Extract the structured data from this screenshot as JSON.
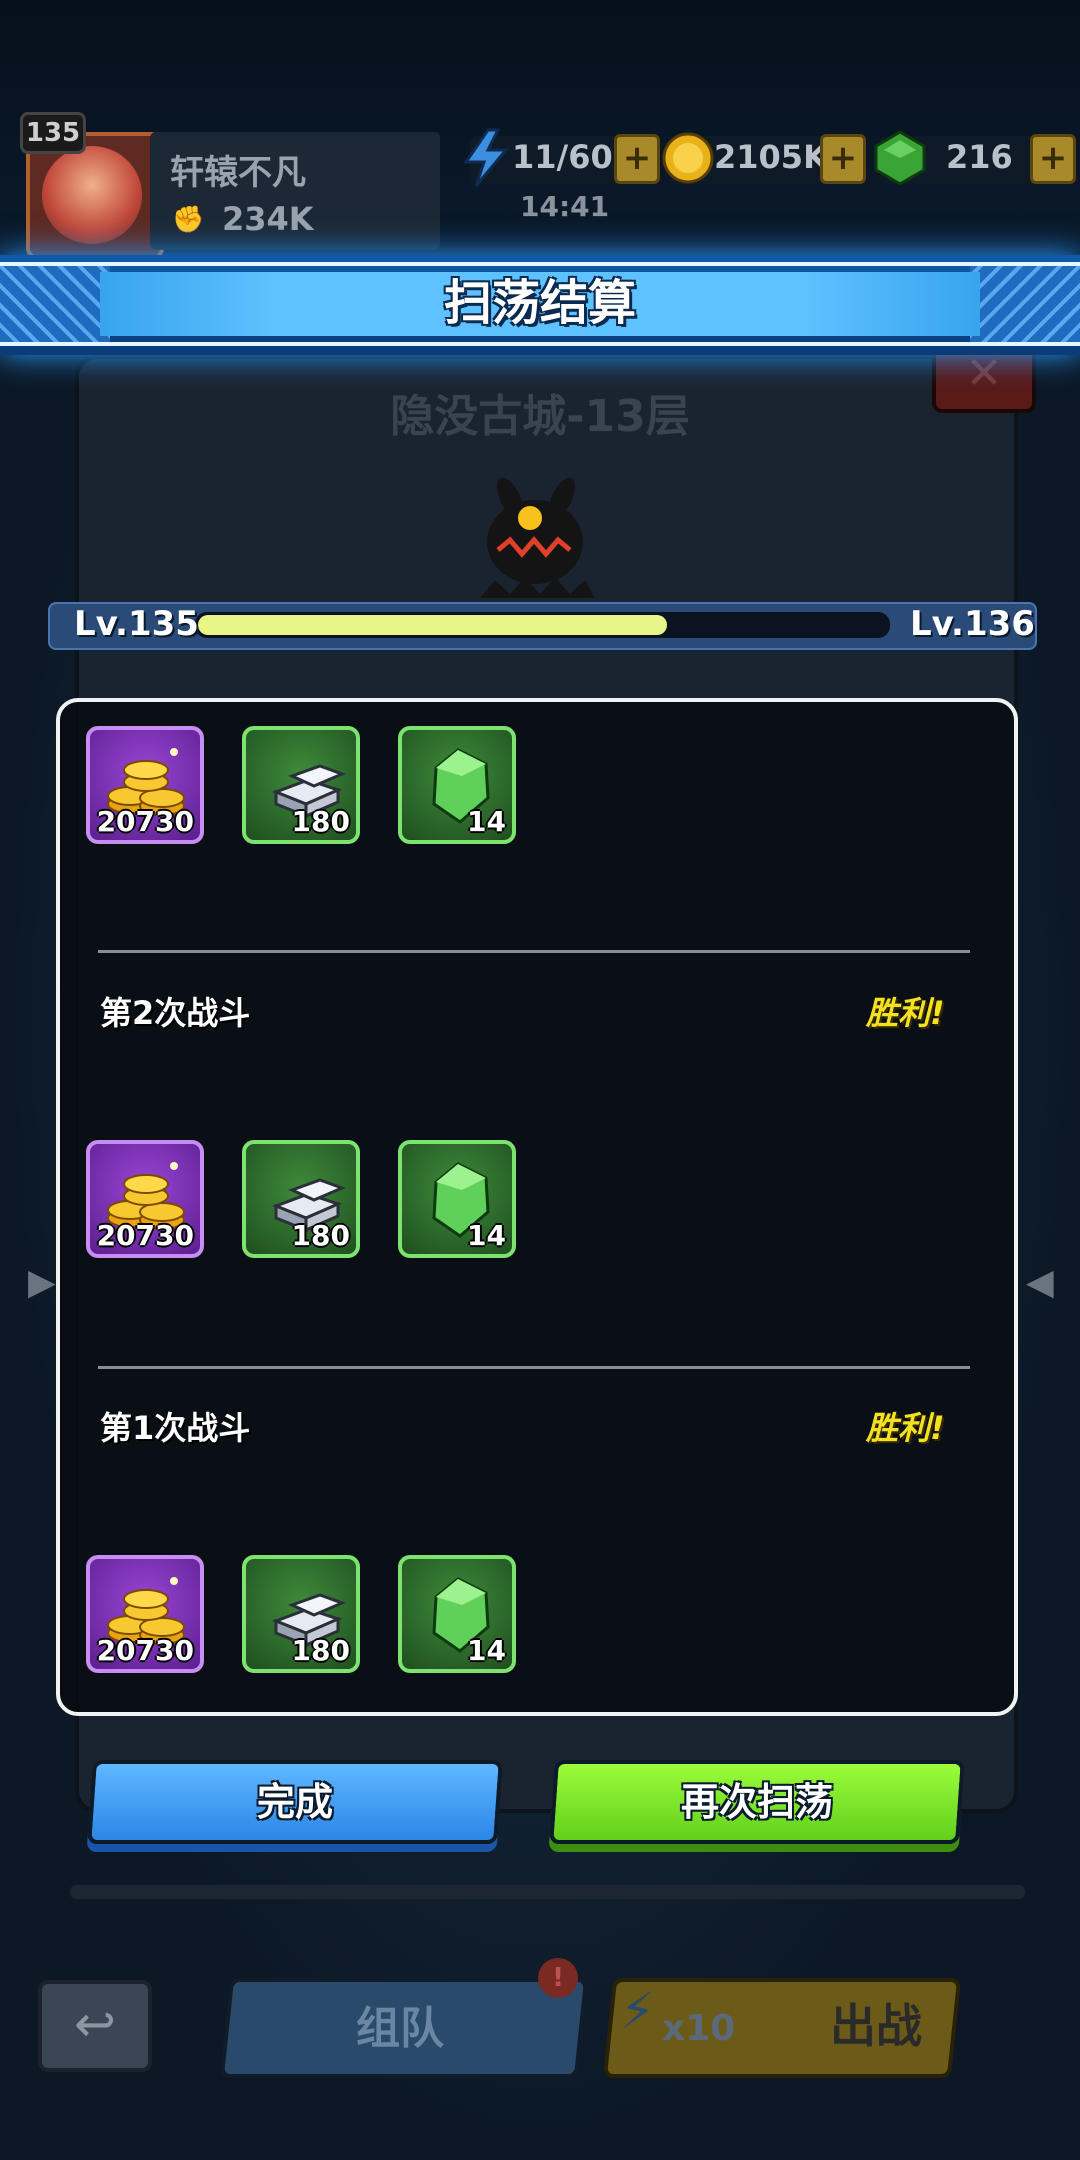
{
  "player": {
    "level": "135",
    "name": "轩辕不凡",
    "power": "234K"
  },
  "resources": {
    "energy": "11/60",
    "timer": "14:41",
    "gold": "2105K",
    "gems": "216",
    "plus": "+"
  },
  "background": {
    "stage_title": "隐没古城-13层"
  },
  "banner": {
    "title": "扫荡结算"
  },
  "level_bar": {
    "current": "Lv.135",
    "next": "Lv.136",
    "progress": 0.68
  },
  "colors": {
    "victory": "#f5e21e",
    "done_button": "#2c86e6",
    "again_button": "#62d01c",
    "banner": "#5ec2ff"
  },
  "rounds": [
    {
      "label": "",
      "result": "",
      "rewards": [
        {
          "icon": "gold-coins-icon",
          "qty": "20730"
        },
        {
          "icon": "silver-ingot-icon",
          "qty": "180"
        },
        {
          "icon": "green-crystal-icon",
          "qty": "14"
        }
      ]
    },
    {
      "label": "第2次战斗",
      "result": "胜利!",
      "rewards": [
        {
          "icon": "gold-coins-icon",
          "qty": "20730"
        },
        {
          "icon": "silver-ingot-icon",
          "qty": "180"
        },
        {
          "icon": "green-crystal-icon",
          "qty": "14"
        }
      ]
    },
    {
      "label": "第1次战斗",
      "result": "胜利!",
      "rewards": [
        {
          "icon": "gold-coins-icon",
          "qty": "20730"
        },
        {
          "icon": "silver-ingot-icon",
          "qty": "180"
        },
        {
          "icon": "green-crystal-icon",
          "qty": "14"
        }
      ]
    }
  ],
  "buttons": {
    "done": "完成",
    "sweep_again": "再次扫荡"
  },
  "bottom_bar": {
    "team": "组队",
    "fight": "出战",
    "cost": "x10"
  }
}
